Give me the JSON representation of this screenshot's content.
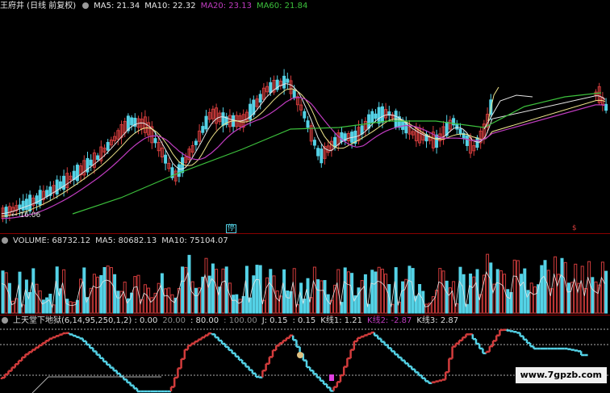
{
  "header": {
    "title": "王府井 (日线 前复权)",
    "items": [
      {
        "label": "MA5: 21.34",
        "color": "#e6e6e6"
      },
      {
        "label": "MA10: 22.32",
        "color": "#e6e6e6"
      },
      {
        "label": "MA20: 23.13",
        "color": "#c03cc0"
      },
      {
        "label": "MA60: 21.84",
        "color": "#3cc03c"
      }
    ]
  },
  "price": {
    "low_label": "← 16.06",
    "small_tag": "停",
    "right_tag": "$"
  },
  "volume": {
    "items": [
      {
        "label": "VOLUME: 68732.12",
        "color": "#e6e6e6"
      },
      {
        "label": "MA5: 80682.13",
        "color": "#e6e6e6"
      },
      {
        "label": "MA10: 75104.07",
        "color": "#e6e6e6"
      }
    ]
  },
  "indicator": {
    "items": [
      {
        "label": "上天堂下地狱(6,14,95,250,1,2) : 0.00",
        "color": "#e6e6e6"
      },
      {
        "label": "20.00",
        "color": "#888888"
      },
      {
        "label": ": 80.00",
        "color": "#e6e6e6"
      },
      {
        "label": ": 100.00",
        "color": "#888888"
      },
      {
        "label": "J: 0.15",
        "color": "#e6e6e6"
      },
      {
        "label": ": 0.15",
        "color": "#e6e6e6"
      },
      {
        "label": "K线1: 1.21",
        "color": "#e6e6e6"
      },
      {
        "label": "K线2: -2.87",
        "color": "#c03cc0"
      },
      {
        "label": "K线3: 2.87",
        "color": "#e6e6e6"
      }
    ]
  },
  "watermark": "www.7gpzb.com",
  "colors": {
    "up": "#d23c3c",
    "down": "#54d2e6",
    "ma5": "#e6e6e6",
    "ma10": "#f0e68c",
    "ma20": "#c03cc0",
    "ma60": "#3cc03c"
  }
}
